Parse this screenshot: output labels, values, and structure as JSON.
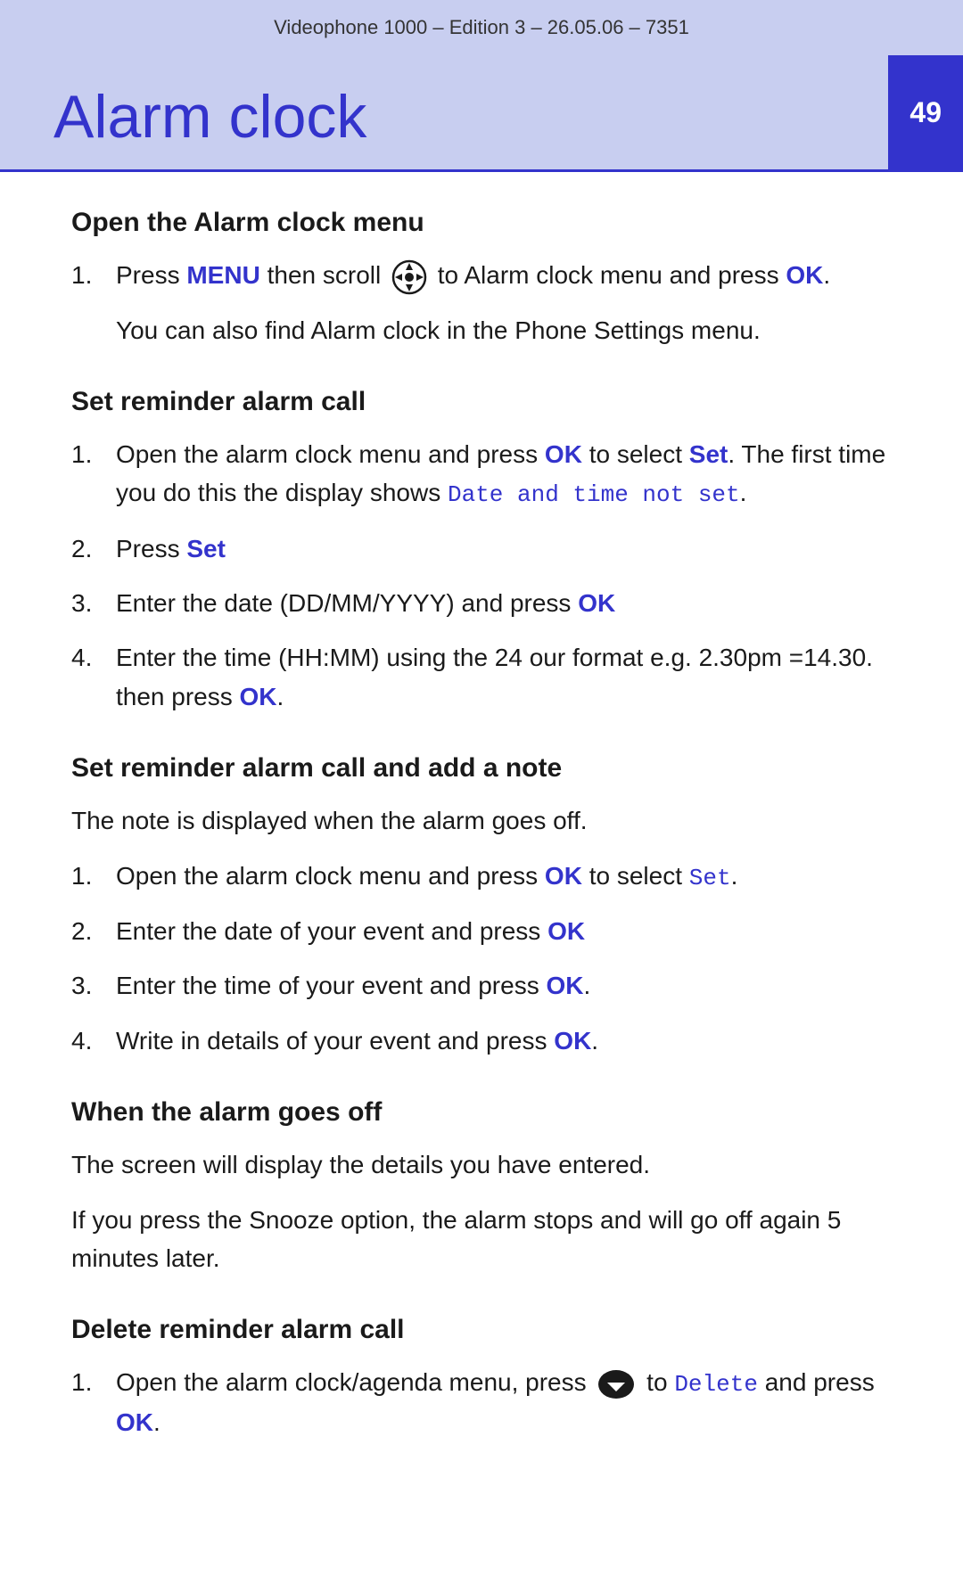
{
  "header": {
    "meta": "Videophone 1000 – Edition 3 – 26.05.06 – 7351",
    "title": "Alarm clock",
    "page_number": "49"
  },
  "sections": [
    {
      "id": "open-menu",
      "heading": "Open the Alarm clock menu",
      "items": [
        {
          "number": "1.",
          "text_parts": [
            {
              "type": "text",
              "content": "Press "
            },
            {
              "type": "blue-bold",
              "content": "MENU"
            },
            {
              "type": "text",
              "content": " then scroll "
            },
            {
              "type": "icon",
              "content": "nav-icon"
            },
            {
              "type": "text",
              "content": " to Alarm clock menu and press "
            },
            {
              "type": "blue-bold",
              "content": "OK"
            },
            {
              "type": "text",
              "content": "."
            }
          ]
        }
      ],
      "extra_paragraph": "You can also find Alarm clock in the Phone Settings menu."
    },
    {
      "id": "set-reminder",
      "heading": "Set reminder alarm call",
      "items": [
        {
          "number": "1.",
          "text_parts": [
            {
              "type": "text",
              "content": "Open the alarm clock menu and press "
            },
            {
              "type": "blue-bold",
              "content": "OK"
            },
            {
              "type": "text",
              "content": " to select "
            },
            {
              "type": "blue-bold",
              "content": "Set"
            },
            {
              "type": "text",
              "content": ". The first time you do this the display shows "
            },
            {
              "type": "monospace",
              "content": "Date and time not set"
            },
            {
              "type": "text",
              "content": "."
            }
          ]
        },
        {
          "number": "2.",
          "text_parts": [
            {
              "type": "text",
              "content": "Press "
            },
            {
              "type": "blue-bold",
              "content": "Set"
            }
          ]
        },
        {
          "number": "3.",
          "text_parts": [
            {
              "type": "text",
              "content": "Enter the date (DD/MM/YYYY) and press "
            },
            {
              "type": "blue-bold",
              "content": "OK"
            }
          ]
        },
        {
          "number": "4.",
          "text_parts": [
            {
              "type": "text",
              "content": "Enter the time (HH:MM) using the 24 our format e.g. 2.30pm =14.30. then press "
            },
            {
              "type": "blue-bold",
              "content": "OK"
            },
            {
              "type": "text",
              "content": "."
            }
          ]
        }
      ]
    },
    {
      "id": "set-reminder-note",
      "heading": "Set reminder alarm call and add a note",
      "intro": "The note is displayed when the alarm goes off.",
      "items": [
        {
          "number": "1.",
          "text_parts": [
            {
              "type": "text",
              "content": "Open the alarm clock menu and press "
            },
            {
              "type": "blue-bold",
              "content": "OK"
            },
            {
              "type": "text",
              "content": " to select "
            },
            {
              "type": "monospace",
              "content": "Set"
            },
            {
              "type": "text",
              "content": "."
            }
          ]
        },
        {
          "number": "2.",
          "text_parts": [
            {
              "type": "text",
              "content": "Enter the date of your event and press "
            },
            {
              "type": "blue-bold",
              "content": "OK"
            }
          ]
        },
        {
          "number": "3.",
          "text_parts": [
            {
              "type": "text",
              "content": "Enter the time of your event and press "
            },
            {
              "type": "blue-bold",
              "content": "OK"
            },
            {
              "type": "text",
              "content": "."
            }
          ]
        },
        {
          "number": "4.",
          "text_parts": [
            {
              "type": "text",
              "content": "Write in details of your event and press "
            },
            {
              "type": "blue-bold",
              "content": "OK"
            },
            {
              "type": "text",
              "content": "."
            }
          ]
        }
      ]
    },
    {
      "id": "alarm-goes-off",
      "heading": "When the alarm goes off",
      "paragraphs": [
        "The screen will display the details you have entered.",
        "If you press the Snooze option, the alarm stops and will go off again 5 minutes later."
      ]
    },
    {
      "id": "delete-reminder",
      "heading": "Delete reminder alarm call",
      "items": [
        {
          "number": "1.",
          "text_parts": [
            {
              "type": "text",
              "content": "Open the alarm clock/agenda menu, press "
            },
            {
              "type": "icon",
              "content": "arrow-icon"
            },
            {
              "type": "text",
              "content": " to "
            },
            {
              "type": "monospace",
              "content": "Delete"
            },
            {
              "type": "text",
              "content": " and press "
            },
            {
              "type": "blue-bold",
              "content": "OK"
            },
            {
              "type": "text",
              "content": "."
            }
          ]
        }
      ]
    }
  ]
}
